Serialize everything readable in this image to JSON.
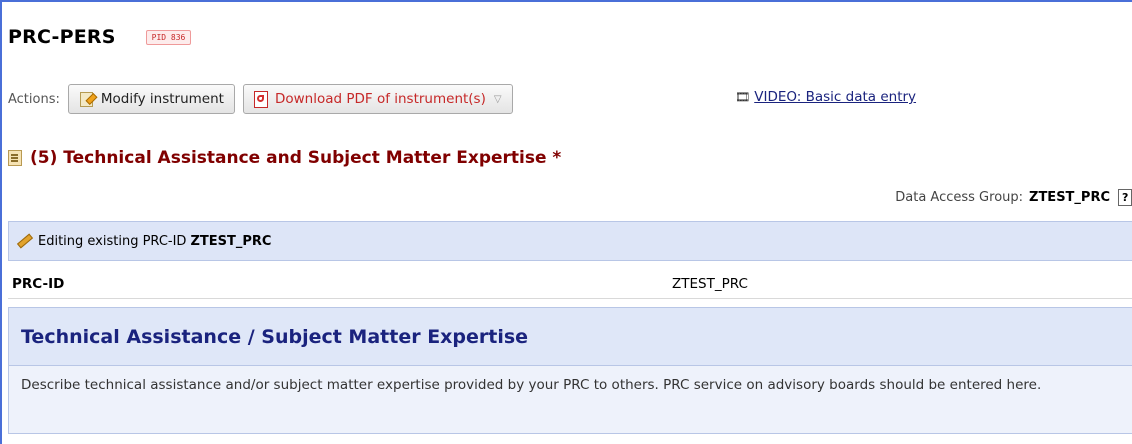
{
  "header": {
    "project_title": "PRC-PERS",
    "pid_badge": "PID 836"
  },
  "actions": {
    "label": "Actions:",
    "modify_button": "Modify instrument",
    "pdf_button": "Download PDF of instrument(s)",
    "video_link": "VIDEO: Basic data entry"
  },
  "form": {
    "title": "(5) Technical Assistance and Subject Matter Expertise *"
  },
  "dag": {
    "label": "Data Access Group:",
    "value": "ZTEST_PRC",
    "help": "?"
  },
  "edit_banner": {
    "prefix": "Editing existing PRC-ID",
    "record_id": "ZTEST_PRC"
  },
  "record_field": {
    "label": "PRC-ID",
    "value": "ZTEST_PRC"
  },
  "section": {
    "title": "Technical Assistance / Subject Matter Expertise",
    "description": "Describe technical assistance and/or subject matter expertise provided by your PRC to others. PRC service on advisory boards should be entered here."
  },
  "icons": {
    "modify": "edit-document-icon",
    "pdf": "pdf-icon",
    "video": "film-icon",
    "form": "form-icon",
    "pencil": "pencil-icon"
  },
  "colors": {
    "form_title": "#800000",
    "section_title": "#1a237e",
    "banner_bg": "#dde5f7",
    "pid_badge": "#c62828"
  }
}
